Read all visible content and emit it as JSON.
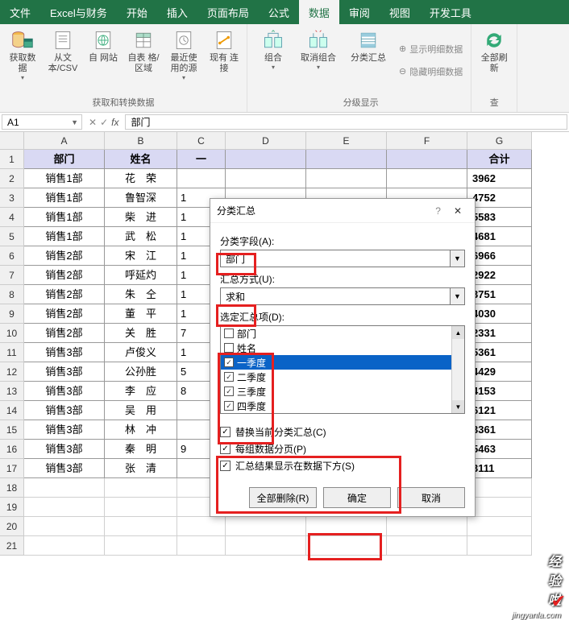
{
  "tabs": {
    "file": "文件",
    "excel": "Excel与财务",
    "start": "开始",
    "insert": "插入",
    "layout": "页面布局",
    "formula": "公式",
    "data": "数据",
    "review": "审阅",
    "view": "视图",
    "dev": "开发工具"
  },
  "ribbon": {
    "get_data": "获取数\n据",
    "from_csv": "从文\n本/CSV",
    "from_web": "自\n网站",
    "from_table": "自表\n格/区域",
    "recent": "最近使\n用的源",
    "exist_conn": "现有\n连接",
    "group1_label": "获取和转换数据",
    "group": "组合",
    "ungroup": "取消组合",
    "subtotal": "分类汇总",
    "show_detail": "显示明细数据",
    "hide_detail": "隐藏明细数据",
    "group2_label": "分级显示",
    "refresh": "全部刷新",
    "group3_label": "查"
  },
  "namebox": "A1",
  "fx_value": "部门",
  "columns": [
    "A",
    "B",
    "C",
    "D",
    "E",
    "F",
    "G"
  ],
  "headers": {
    "A": "部门",
    "B": "姓名",
    "C": "一",
    "G": "合计"
  },
  "rows": [
    {
      "n": 1,
      "type": "hdr"
    },
    {
      "n": 2,
      "A": "销售1部",
      "B": "花　荣",
      "C": "",
      "G": "3962"
    },
    {
      "n": 3,
      "A": "销售1部",
      "B": "鲁智深",
      "C": "1",
      "G": "4752"
    },
    {
      "n": 4,
      "A": "销售1部",
      "B": "柴　进",
      "C": "1",
      "G": "5583"
    },
    {
      "n": 5,
      "A": "销售1部",
      "B": "武　松",
      "C": "1",
      "G": "4681"
    },
    {
      "n": 6,
      "A": "销售2部",
      "B": "宋　江",
      "C": "1",
      "G": "6966"
    },
    {
      "n": 7,
      "A": "销售2部",
      "B": "呼延灼",
      "C": "1",
      "G": "2922"
    },
    {
      "n": 8,
      "A": "销售2部",
      "B": "朱　仝",
      "C": "1",
      "G": "3751"
    },
    {
      "n": 9,
      "A": "销售2部",
      "B": "董　平",
      "C": "1",
      "G": "4030"
    },
    {
      "n": 10,
      "A": "销售2部",
      "B": "关　胜",
      "C": "7",
      "G": "2331"
    },
    {
      "n": 11,
      "A": "销售3部",
      "B": "卢俊义",
      "C": "1",
      "G": "5361"
    },
    {
      "n": 12,
      "A": "销售3部",
      "B": "公孙胜",
      "C": "5",
      "G": "4429"
    },
    {
      "n": 13,
      "A": "销售3部",
      "B": "李　应",
      "C": "8",
      "G": "4153"
    },
    {
      "n": 14,
      "A": "销售3部",
      "B": "吴　用",
      "C": "",
      "G": "6121"
    },
    {
      "n": 15,
      "A": "销售3部",
      "B": "林　冲",
      "C": "",
      "G": "3361"
    },
    {
      "n": 16,
      "A": "销售3部",
      "B": "秦　明",
      "C": "9",
      "G": "5463"
    },
    {
      "n": 17,
      "A": "销售3部",
      "B": "张　清",
      "C": "",
      "G": "3111"
    },
    {
      "n": 18,
      "type": "empty"
    },
    {
      "n": 19,
      "type": "empty"
    },
    {
      "n": 20,
      "type": "empty"
    },
    {
      "n": 21,
      "type": "empty"
    }
  ],
  "dialog": {
    "title": "分类汇总",
    "help": "?",
    "close": "✕",
    "label_field": "分类字段(A):",
    "field_value": "部门",
    "label_method": "汇总方式(U):",
    "method_value": "求和",
    "label_items": "选定汇总项(D):",
    "items": [
      {
        "label": "部门",
        "checked": false,
        "sel": false
      },
      {
        "label": "姓名",
        "checked": false,
        "sel": false
      },
      {
        "label": "一季度",
        "checked": true,
        "sel": true
      },
      {
        "label": "二季度",
        "checked": true,
        "sel": false
      },
      {
        "label": "三季度",
        "checked": true,
        "sel": false
      },
      {
        "label": "四季度",
        "checked": true,
        "sel": false
      }
    ],
    "opt_replace": "替换当前分类汇总(C)",
    "opt_page": "每组数据分页(P)",
    "opt_below": "汇总结果显示在数据下方(S)",
    "btn_removeall": "全部删除(R)",
    "btn_ok": "确定",
    "btn_cancel": "取消"
  },
  "watermark": {
    "main": "经验啦",
    "sub": "jingyanla.com"
  }
}
